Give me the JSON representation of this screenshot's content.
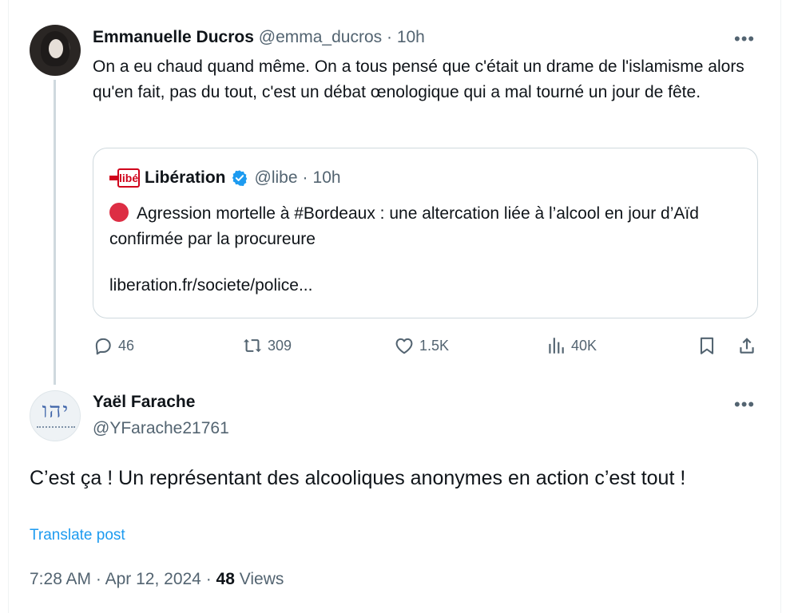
{
  "parent_tweet": {
    "author_name": "Emmanuelle Ducros",
    "author_handle": "@emma_ducros",
    "separator": "·",
    "time": "10h",
    "more_label": "•••",
    "text": "On a eu chaud quand même. On a tous pensé que c'était un drame de l'islamisme alors qu'en fait, pas du tout, c'est un débat œnologique qui a mal tourné un jour de fête.",
    "quote": {
      "logo_text": "libé",
      "author_name": "Libération",
      "author_handle": "@libe",
      "separator": "·",
      "time": "10h",
      "text": "Agression mortelle à #Bordeaux : une altercation liée à l’alcool en jour d’Aïd confirmée par la procureure",
      "link": "liberation.fr/societe/police..."
    },
    "actions": {
      "replies": "46",
      "reposts": "309",
      "likes": "1.5K",
      "views": "40K"
    }
  },
  "reply": {
    "author_name": "Yaël Farache",
    "author_handle": "@YFarache21761",
    "more_label": "•••",
    "avatar_glyph": "יהו",
    "text": "C’est ça ! Un représentant des alcooliques anonymes en action c’est tout !",
    "translate_label": "Translate post",
    "time": "7:28 AM",
    "separator": "·",
    "date": "Apr 12, 2024",
    "views_count": "48",
    "views_label": "Views"
  },
  "colors": {
    "text": "#0f1419",
    "secondary": "#536471",
    "link": "#1d9bf0",
    "border": "#cfd9de",
    "verified": "#1d9bf0",
    "libe_red": "#d0021b"
  }
}
